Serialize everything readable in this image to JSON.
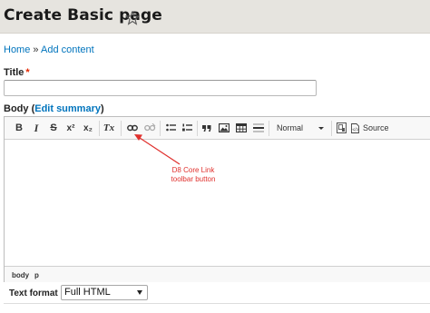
{
  "page": {
    "title": "Create Basic page",
    "star_icon": "star-outline-icon"
  },
  "breadcrumb": {
    "home": "Home",
    "separator": "»",
    "current": "Add content"
  },
  "title_field": {
    "label": "Title",
    "required_mark": "*",
    "value": ""
  },
  "body_field": {
    "label": "Body",
    "open_paren": "(",
    "edit_summary": "Edit summary",
    "close_paren": ")"
  },
  "toolbar": {
    "bold": "B",
    "italic": "I",
    "strike": "S",
    "superscript": "x²",
    "subscript": "x₂",
    "remove_format": "Tx",
    "format_value": "Normal",
    "source": "Source",
    "icons": [
      "bold-icon",
      "italic-icon",
      "strikethrough-icon",
      "superscript-icon",
      "subscript-icon",
      "remove-format-icon",
      "link-icon",
      "unlink-icon",
      "bulleted-list-icon",
      "numbered-list-icon",
      "blockquote-icon",
      "image-icon",
      "table-icon",
      "horizontal-rule-icon",
      "format-dropdown",
      "show-blocks-icon",
      "source-icon"
    ]
  },
  "statusbar": {
    "path": [
      "body",
      "p"
    ]
  },
  "annotation": {
    "line1": "D8 Core Link",
    "line2": "toolbar button",
    "color": "#e0302d"
  },
  "text_format": {
    "label": "Text format",
    "value": "Full HTML"
  },
  "colors": {
    "link": "#0074bd",
    "required": "#e32700",
    "header_bg": "#e6e4df"
  }
}
